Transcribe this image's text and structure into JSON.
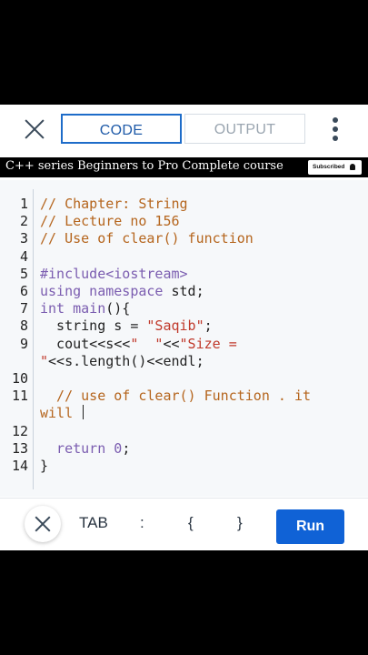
{
  "header": {
    "tabs": [
      {
        "label": "CODE",
        "active": true
      },
      {
        "label": "OUTPUT",
        "active": false
      }
    ]
  },
  "banner": {
    "title": "C++ series Beginners to Pro Complete course",
    "subscribe_label": "Subscribed"
  },
  "editor": {
    "line_numbers": [
      "1",
      "2",
      "3",
      "4",
      "5",
      "6",
      "7",
      "8",
      "9",
      "10",
      "11",
      "12",
      "13",
      "14"
    ],
    "lines": [
      {
        "segments": [
          {
            "t": "// Chapter: String",
            "c": "cm"
          }
        ]
      },
      {
        "segments": [
          {
            "t": "// Lecture no 156",
            "c": "cm"
          }
        ]
      },
      {
        "segments": [
          {
            "t": "// Use of clear() function",
            "c": "cm"
          }
        ]
      },
      {
        "segments": []
      },
      {
        "segments": [
          {
            "t": "#include<iostream>",
            "c": "kw"
          }
        ]
      },
      {
        "segments": [
          {
            "t": "using namespace ",
            "c": "kw"
          },
          {
            "t": "std;",
            "c": ""
          }
        ]
      },
      {
        "segments": [
          {
            "t": "int ",
            "c": "kw"
          },
          {
            "t": "main",
            "c": "kw"
          },
          {
            "t": "(){",
            "c": ""
          }
        ]
      },
      {
        "segments": [
          {
            "t": "  string s = ",
            "c": ""
          },
          {
            "t": "\"Saqib\"",
            "c": "str"
          },
          {
            "t": ";",
            "c": ""
          }
        ]
      },
      {
        "segments": [
          {
            "t": "  cout<<s<<",
            "c": ""
          },
          {
            "t": "\"  \"",
            "c": "str"
          },
          {
            "t": "<<",
            "c": ""
          },
          {
            "t": "\"Size =",
            "c": "str"
          }
        ]
      },
      {
        "segments": [
          {
            "t": "\"",
            "c": "str"
          },
          {
            "t": "<<s.length()<<endl;",
            "c": ""
          }
        ]
      },
      {
        "segments": []
      },
      {
        "segments": [
          {
            "t": "  // use of clear() Function . it",
            "c": "cm"
          }
        ]
      },
      {
        "segments": [
          {
            "t": "will ",
            "c": "cm"
          }
        ],
        "caret": true
      },
      {
        "segments": []
      },
      {
        "segments": [
          {
            "t": "  return ",
            "c": "kw"
          },
          {
            "t": "0",
            "c": "num"
          },
          {
            "t": ";",
            "c": ""
          }
        ]
      },
      {
        "segments": [
          {
            "t": "}",
            "c": ""
          }
        ]
      }
    ]
  },
  "toolbar": {
    "keys": [
      "TAB",
      ":",
      "{",
      "}"
    ],
    "run_label": "Run"
  },
  "colors": {
    "accent": "#1062d6",
    "comment": "#b5651d",
    "keyword": "#7b5db0",
    "string": "#c0392b"
  },
  "icons": [
    "close-icon",
    "more-vertical-icon",
    "bell-icon",
    "keyboard-close-icon"
  ]
}
